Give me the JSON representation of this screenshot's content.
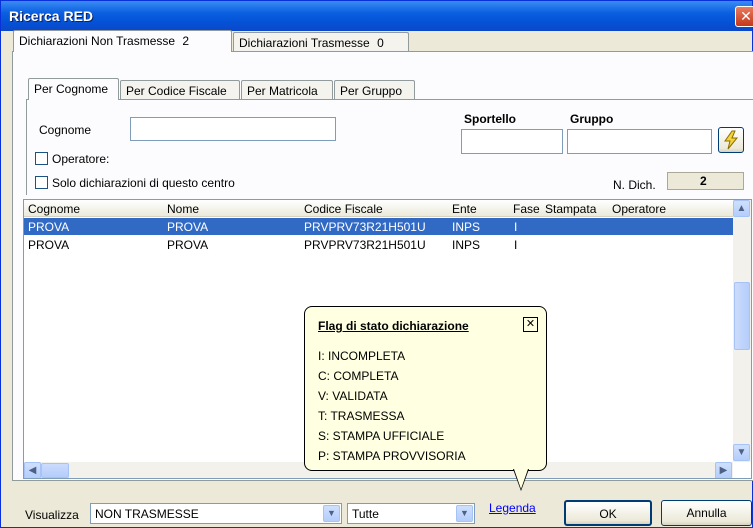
{
  "window": {
    "title": "Ricerca RED",
    "close_glyph": "✕"
  },
  "outer_tabs": [
    {
      "label": "Dichiarazioni Non Trasmesse",
      "count": "2"
    },
    {
      "label": "Dichiarazioni  Trasmesse",
      "count": "0"
    }
  ],
  "inner_tabs": [
    "Per Cognome",
    "Per Codice Fiscale",
    "Per Matricola",
    "Per Gruppo"
  ],
  "search": {
    "cognome_label": "Cognome",
    "cognome_value": "",
    "sportello_label": "Sportello",
    "sportello_value": "",
    "gruppo_label": "Gruppo",
    "gruppo_value": "",
    "search_icon": "lightning-icon",
    "operatore_label": "Operatore:",
    "solo_label": "Solo dichiarazioni di questo centro",
    "ndich_label": "N. Dich.",
    "ndich_value": "2"
  },
  "table": {
    "columns": [
      "Cognome",
      "Nome",
      "Codice Fiscale",
      "Ente",
      "Fase",
      "Stampata",
      "Operatore"
    ],
    "rows": [
      {
        "cognome": "PROVA",
        "nome": "PROVA",
        "cf": "PRVPRV73R21H501U",
        "ente": "INPS",
        "fase": "I",
        "stampata": "",
        "operatore": ""
      },
      {
        "cognome": "PROVA",
        "nome": "PROVA",
        "cf": "PRVPRV73R21H501U",
        "ente": "INPS",
        "fase": "I",
        "stampata": "",
        "operatore": ""
      }
    ]
  },
  "legend_popup": {
    "title": "Flag di stato dichiarazione",
    "close_glyph": "✕",
    "items": [
      "I:  INCOMPLETA",
      "C: COMPLETA",
      "V: VALIDATA",
      "T: TRASMESSA",
      "S: STAMPA UFFICIALE",
      "P: STAMPA PROVVISORIA"
    ]
  },
  "footer": {
    "visualizza_label": "Visualizza",
    "visualizza_value": "NON TRASMESSE",
    "filter_value": "Tutte",
    "legenda_link": "Legenda",
    "ok_label": "OK",
    "annulla_label": "Annulla"
  },
  "colors": {
    "title_bar": "#0a5fe0",
    "selection": "#316ac5",
    "tooltip_bg": "#ffffe1",
    "dialog_bg": "#ece9d8"
  }
}
